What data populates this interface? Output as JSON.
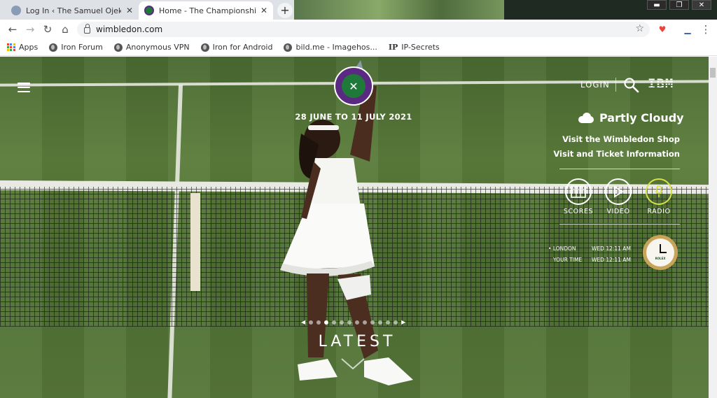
{
  "browser": {
    "tabs": [
      {
        "title": "Log In ‹ The Samuel Ojekwe Blog",
        "close": "✕",
        "active": false
      },
      {
        "title": "Home - The Championships, Wimbledon",
        "close": "✕",
        "active": true
      }
    ],
    "new_tab": "+",
    "window_controls": {
      "minimize": "▬",
      "restore": "❐",
      "close": "✕"
    },
    "url": "wimbledon.com",
    "nav": {
      "back": "←",
      "forward": "→",
      "reload": "↻",
      "home": "⌂",
      "star": "☆",
      "menu": "⋮"
    },
    "bookmarks": [
      {
        "label": "Apps",
        "icon": "apps-grid-icon"
      },
      {
        "label": "Iron Forum",
        "icon": "globe-icon"
      },
      {
        "label": "Anonymous VPN",
        "icon": "globe-icon"
      },
      {
        "label": "Iron for Android",
        "icon": "globe-icon"
      },
      {
        "label": "bild.me - Imagehos...",
        "icon": "globe-icon"
      },
      {
        "label": "IP-Secrets",
        "icon": "ip-icon"
      }
    ],
    "ip_badge": "IP"
  },
  "site": {
    "menu_icon": "hamburger-icon",
    "dates": "28 JUNE TO 11 JULY 2021",
    "login": "LOGIN",
    "ibm": "IBM",
    "weather": "Partly Cloudy",
    "shop_link": "Visit the Wimbledon Shop",
    "ticket_link": "Visit and Ticket Information",
    "media": [
      {
        "label": "SCORES",
        "icon": "scores-icon"
      },
      {
        "label": "VIDEO",
        "icon": "play-icon"
      },
      {
        "label": "RADIO",
        "icon": "microphone-icon"
      }
    ],
    "times": [
      {
        "label": "LONDON",
        "value": "WED 12:11 AM",
        "bullet": "•"
      },
      {
        "label": "YOUR TIME",
        "value": "WED 12:11 AM",
        "bullet": ""
      }
    ],
    "clock_brand": "ROLEX",
    "carousel": {
      "count": 12,
      "active_index": 2,
      "prev": "◀",
      "next": "▶"
    },
    "latest": "LATEST"
  },
  "colors": {
    "wimbledon_purple": "#5a2a82",
    "wimbledon_green": "#1f7a3a",
    "radio_accent": "#d8e04a"
  }
}
